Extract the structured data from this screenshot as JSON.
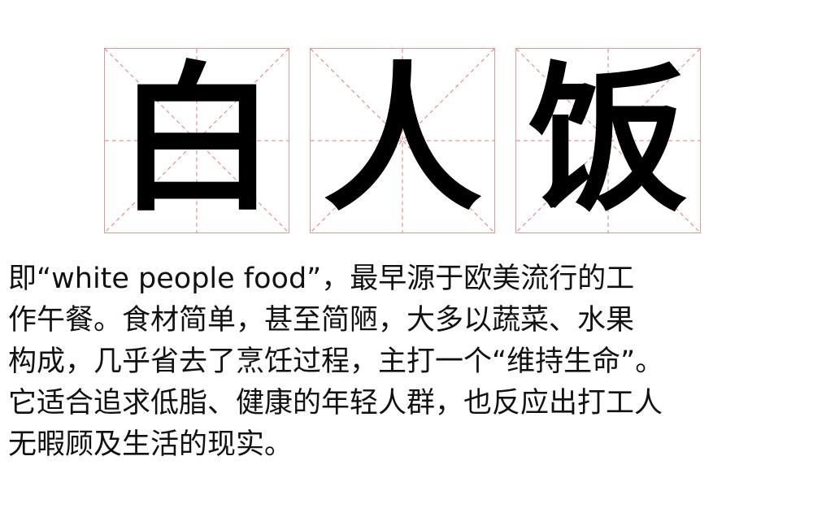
{
  "title": {
    "chars": [
      "白",
      "人",
      "饭"
    ]
  },
  "colors": {
    "guide_line": "#e07a7a",
    "grid_border": "#e09a9a",
    "text": "#111111"
  },
  "paragraph": {
    "lines": [
      "即“white people food”，最早源于欧美流行的工",
      "作午餐。食材简单，甚至简陋，大多以蔬菜、水果",
      "构成，几乎省去了烹饪过程，主打一个“维持生命”。",
      "它适合追求低脂、健康的年轻人群，也反应出打工人",
      "无暇顾及生活的现实。"
    ]
  }
}
